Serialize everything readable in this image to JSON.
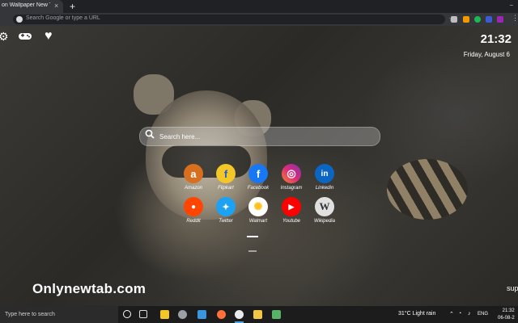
{
  "browser": {
    "tab_title": "on Wallpaper New Tab The",
    "tab_close": "×",
    "new_tab": "+",
    "window_minimize": "−",
    "omnibox_placeholder": "Search Google or type a URL",
    "menu": "⋮"
  },
  "page": {
    "clock": "21:32",
    "date": "Friday, August 6",
    "search_placeholder": "Search here...",
    "brand": "Onlynewtab.com",
    "partial_text": "sup"
  },
  "shortcuts": [
    {
      "label": "Amazon",
      "glyph": "a",
      "color": "#d76f1e"
    },
    {
      "label": "Flipkart",
      "glyph": "f",
      "color": "#f3c727"
    },
    {
      "label": "Facebook",
      "glyph": "f",
      "color": "#1877f2"
    },
    {
      "label": "Instagram",
      "glyph": "◎",
      "color": "#c32aa3"
    },
    {
      "label": "Linkedin",
      "glyph": "in",
      "color": "#0a66c2"
    },
    {
      "label": "Reddit",
      "glyph": "●",
      "color": "#ff4500"
    },
    {
      "label": "Twitter",
      "glyph": "✦",
      "color": "#1da1f2"
    },
    {
      "label": "Walmart",
      "glyph": "✺",
      "color": "#ffffff"
    },
    {
      "label": "Youtube",
      "glyph": "▶",
      "color": "#ff0000"
    },
    {
      "label": "Wikipedia",
      "glyph": "W",
      "color": "#e0e0e0"
    }
  ],
  "taskbar": {
    "search_placeholder": "Type here to search",
    "weather": "31°C  Light rain",
    "lang": "ENG",
    "time": "21:32",
    "date": "06-08-2"
  },
  "icons": {
    "settings": "gear-icon",
    "game": "gamepad-icon",
    "favorite": "heart-icon",
    "search": "search-icon"
  }
}
